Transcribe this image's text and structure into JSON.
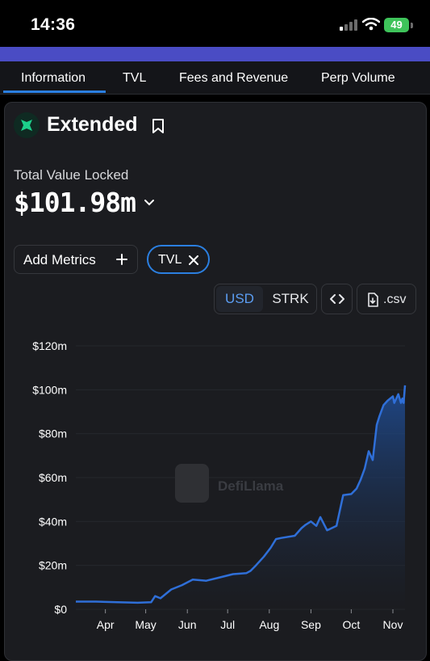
{
  "status_bar": {
    "time": "14:36",
    "battery": "49"
  },
  "tabs": [
    {
      "label": "Information",
      "active": true
    },
    {
      "label": "TVL",
      "active": false
    },
    {
      "label": "Fees and Revenue",
      "active": false
    },
    {
      "label": "Perp Volume",
      "active": false
    }
  ],
  "protocol": {
    "name": "Extended",
    "logo_color": "#1ccf8a",
    "bookmark_icon": "bookmark-icon"
  },
  "tvl": {
    "label": "Total Value Locked",
    "value": "$101.98m"
  },
  "controls": {
    "add_metrics_label": "Add Metrics",
    "add_icon": "plus-icon",
    "active_metric": "TVL",
    "currency_options": [
      "USD",
      "STRK"
    ],
    "selected_currency": "USD",
    "csv_label": ".csv"
  },
  "colors": {
    "accent": "#2b7fe0",
    "line": "#2f6fd8",
    "background": "#1b1c20"
  },
  "chart_data": {
    "type": "area",
    "watermark": "DefiLlama",
    "x_tick_labels": [
      "Apr",
      "May",
      "Jun",
      "Jul",
      "Aug",
      "Sep",
      "Oct",
      "Nov"
    ],
    "y_tick_labels": [
      "$0",
      "$20m",
      "$40m",
      "$60m",
      "$80m",
      "$100m",
      "$120m"
    ],
    "ylim": [
      0,
      120
    ],
    "grid": true,
    "series": [
      {
        "x": [
          "2025-03-10",
          "2025-03-25",
          "2025-04-10",
          "2025-04-25",
          "2025-05-05",
          "2025-05-08",
          "2025-05-12",
          "2025-05-20",
          "2025-05-28",
          "2025-06-05",
          "2025-06-15",
          "2025-06-25",
          "2025-07-05",
          "2025-07-15",
          "2025-07-18",
          "2025-07-22",
          "2025-07-28",
          "2025-08-02",
          "2025-08-06",
          "2025-08-10",
          "2025-08-20",
          "2025-08-25",
          "2025-08-28",
          "2025-09-01",
          "2025-09-05",
          "2025-09-08",
          "2025-09-13",
          "2025-09-15",
          "2025-09-20",
          "2025-09-25",
          "2025-10-01",
          "2025-10-05",
          "2025-10-08",
          "2025-10-11",
          "2025-10-14",
          "2025-10-17",
          "2025-10-20",
          "2025-10-22",
          "2025-10-25",
          "2025-10-28",
          "2025-11-01",
          "2025-11-02",
          "2025-11-05",
          "2025-11-07",
          "2025-11-08",
          "2025-11-09",
          "2025-11-10"
        ],
        "y": [
          3.5,
          3.5,
          3.2,
          3.0,
          3.2,
          6.0,
          5.0,
          9.0,
          11.0,
          13.5,
          13.0,
          14.5,
          16.0,
          16.5,
          17.5,
          20.0,
          24.0,
          28.0,
          32.0,
          32.5,
          33.5,
          37.0,
          38.5,
          40.0,
          38.0,
          42.0,
          36.0,
          36.5,
          38.0,
          52.0,
          52.5,
          55.0,
          59.0,
          64.0,
          72.0,
          68.0,
          84.0,
          88.0,
          93.0,
          95.0,
          97.0,
          94.0,
          98.0,
          94.0,
          96.0,
          94.0,
          102.0
        ]
      }
    ]
  }
}
